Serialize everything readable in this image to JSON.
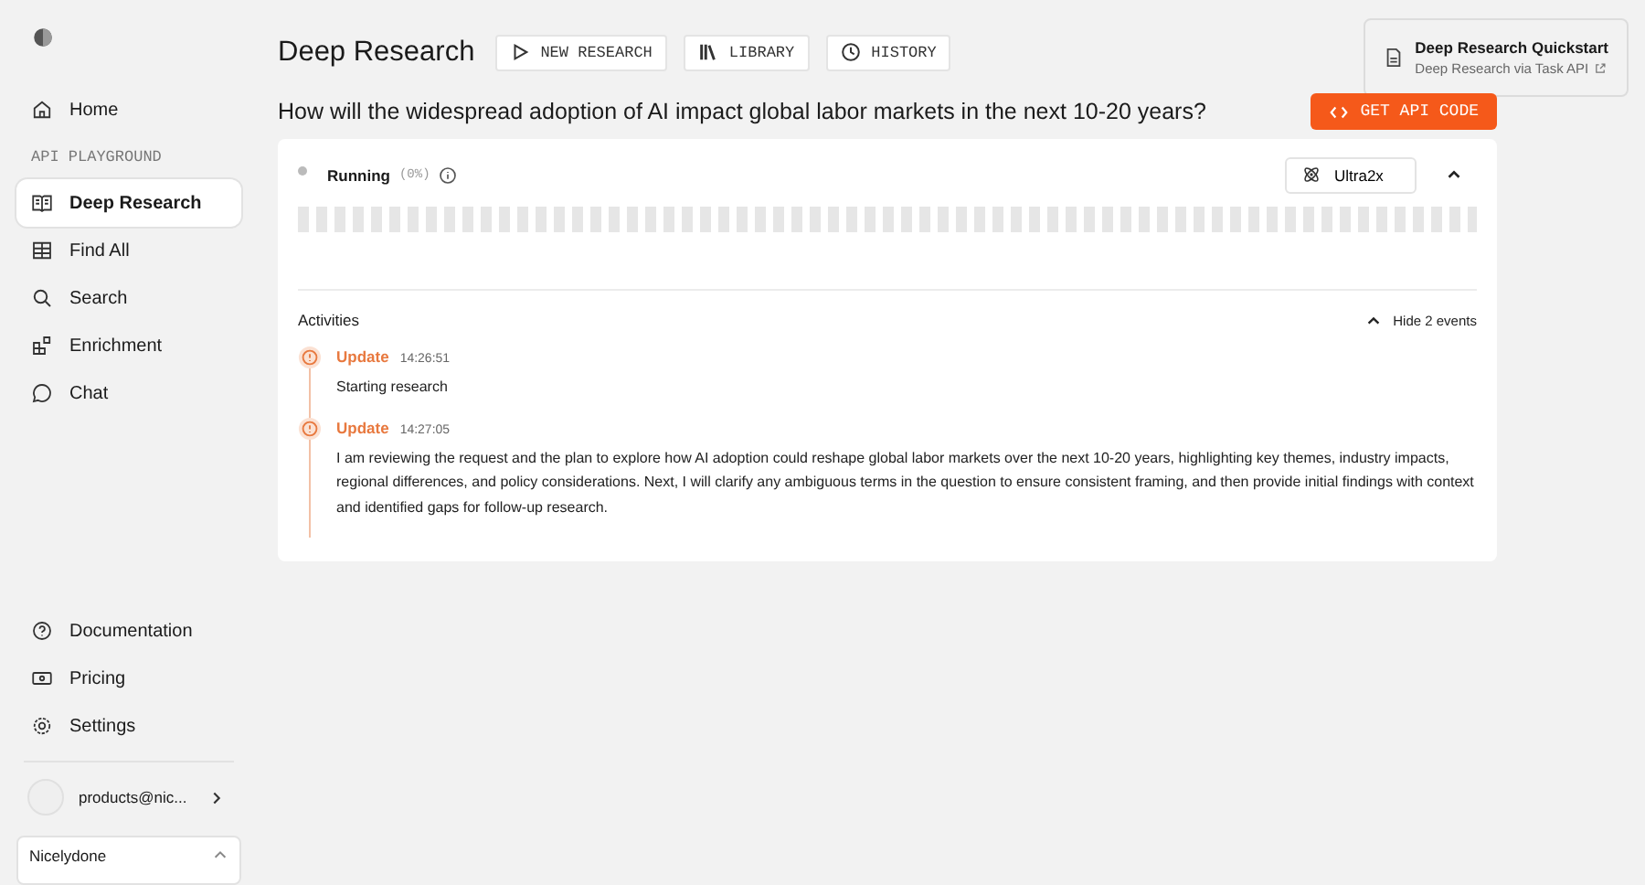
{
  "sidebar": {
    "home": {
      "label": "Home",
      "selected": false
    },
    "section_label": "API PLAYGROUND",
    "items": [
      {
        "label": "Deep Research",
        "selected": true
      },
      {
        "label": "Find All",
        "selected": false
      },
      {
        "label": "Search",
        "selected": false
      },
      {
        "label": "Enrichment",
        "selected": false
      },
      {
        "label": "Chat",
        "selected": false
      }
    ],
    "footer_items": [
      {
        "label": "Documentation"
      },
      {
        "label": "Pricing"
      },
      {
        "label": "Settings"
      }
    ],
    "account": {
      "email": "products@nic..."
    },
    "org": {
      "name": "Nicelydone",
      "expanded": true
    }
  },
  "header": {
    "title": "Deep Research",
    "buttons": [
      {
        "label": "NEW RESEARCH"
      },
      {
        "label": "LIBRARY"
      },
      {
        "label": "HISTORY"
      }
    ],
    "quickstart": {
      "title": "Deep Research Quickstart",
      "subtitle": "Deep Research via Task API"
    }
  },
  "question": "How will the widespread adoption of AI impact global labor markets in the next 10-20 years?",
  "api_button": "GET API CODE",
  "run": {
    "status": "Running",
    "percent": "(0%)",
    "level": 0,
    "processor": "Ultra2x",
    "expanded": true,
    "activities": {
      "title": "Activities",
      "toggle": "Hide 2 events",
      "events": [
        {
          "type": "Update",
          "time": "14:26:51",
          "text": "Starting research"
        },
        {
          "type": "Update",
          "time": "14:27:05",
          "text": "I am reviewing the request and the plan to explore how AI adoption could reshape global labor markets over the next 10-20 years, highlighting key themes, industry impacts, regional differences, and policy considerations. Next, I will clarify any ambiguous terms in the question to ensure consistent framing, and then provide initial findings with context and identified gaps for follow-up research."
        }
      ]
    }
  }
}
